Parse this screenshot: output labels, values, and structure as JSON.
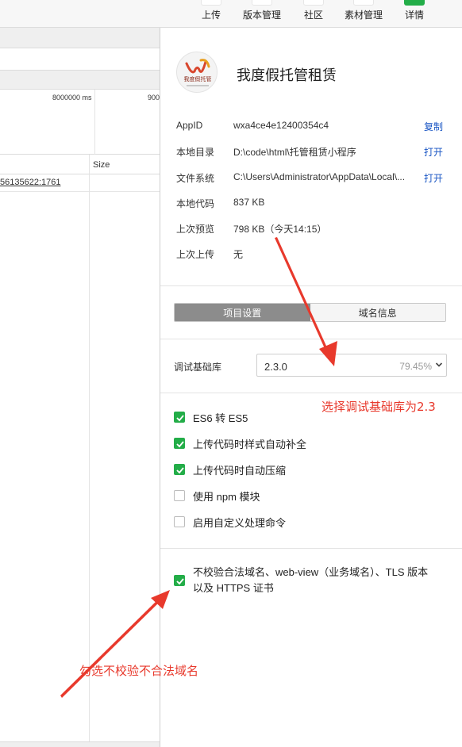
{
  "toolbar": {
    "buttons": [
      {
        "label": "上传",
        "icon": "upload-icon"
      },
      {
        "label": "版本管理",
        "icon": "version-icon"
      },
      {
        "label": "社区",
        "icon": "community-icon"
      },
      {
        "label": "素材管理",
        "icon": "material-icon"
      },
      {
        "label": "详情",
        "icon": "details-icon"
      }
    ]
  },
  "network": {
    "timeline_ticks": [
      "8000000 ms",
      "900"
    ],
    "size_header": "Size",
    "row_link": "56135622:1761"
  },
  "details": {
    "app_name": "我度假托管租赁",
    "logo_text": "我度假托管",
    "info": [
      {
        "key": "AppID",
        "value": "wxa4ce4e12400354c4",
        "action": "复制"
      },
      {
        "key": "本地目录",
        "value": "D:\\code\\html\\托管租赁小程序",
        "action": "打开"
      },
      {
        "key": "文件系统",
        "value": "C:\\Users\\Administrator\\AppData\\Local\\...",
        "action": "打开"
      },
      {
        "key": "本地代码",
        "value": "837 KB",
        "action": ""
      },
      {
        "key": "上次预览",
        "value": "798 KB（今天14:15）",
        "action": ""
      },
      {
        "key": "上次上传",
        "value": "无",
        "action": ""
      }
    ],
    "tabs": [
      {
        "label": "项目设置",
        "active": true
      },
      {
        "label": "域名信息",
        "active": false
      }
    ],
    "debug_lib": {
      "label": "调试基础库",
      "value": "2.3.0",
      "percent": "79.45%"
    },
    "options": [
      {
        "label": "ES6 转 ES5",
        "checked": true
      },
      {
        "label": "上传代码时样式自动补全",
        "checked": true
      },
      {
        "label": "上传代码时自动压缩",
        "checked": true
      },
      {
        "label": "使用 npm 模块",
        "checked": false
      },
      {
        "label": "启用自定义处理命令",
        "checked": false
      }
    ],
    "domain_option": {
      "label": "不校验合法域名、web-view（业务域名）、TLS 版本以及 HTTPS 证书",
      "checked": true
    }
  },
  "annotations": {
    "select_lib": "选择调试基础库为2.3",
    "check_domain": "勾选不校验不合法域名",
    "color": "#e8392c"
  },
  "colors": {
    "accent_green": "#23ad48",
    "link_blue": "#1a56c4",
    "tab_active": "#8c8c8c"
  }
}
